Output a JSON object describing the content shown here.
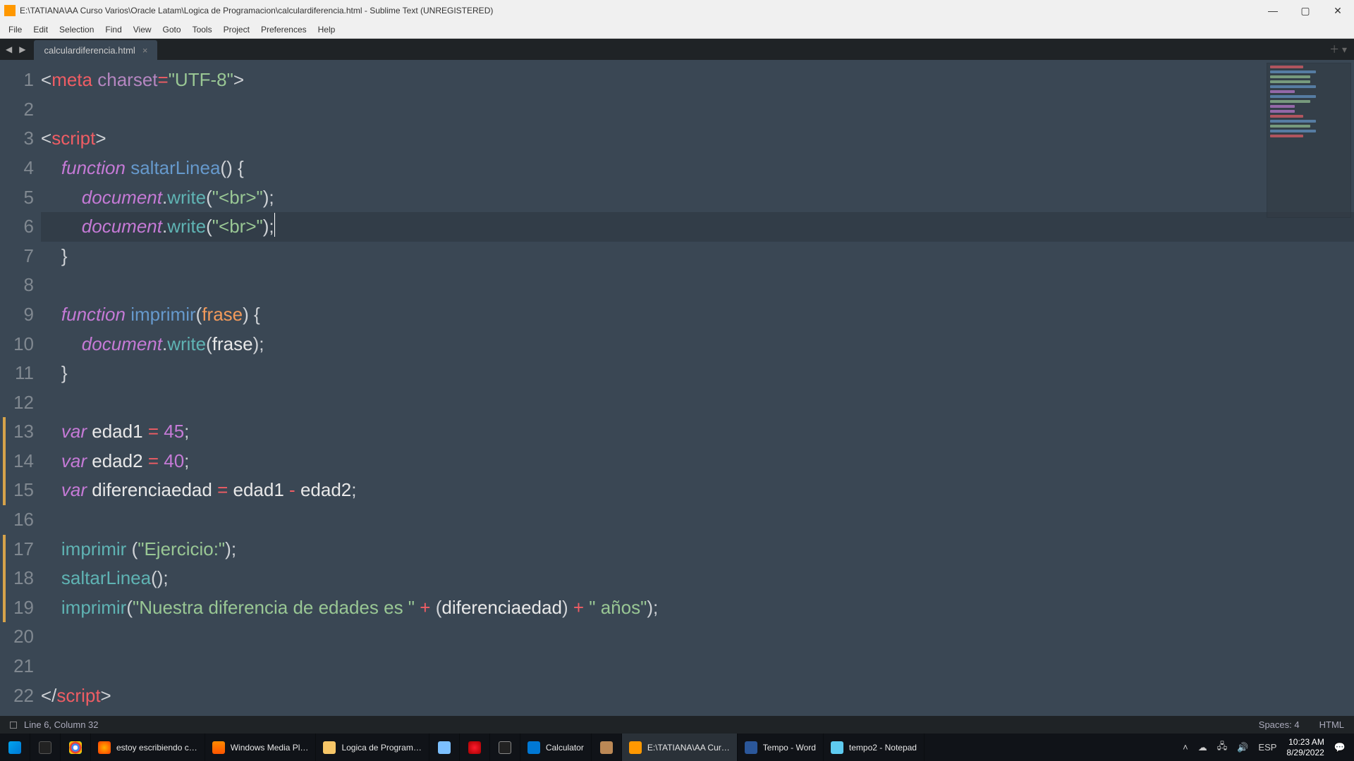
{
  "window": {
    "title_path": "E:\\TATIANA\\AA Curso Varios\\Oracle Latam\\Logica de Programacion\\calculardiferencia.html - Sublime Text (UNREGISTERED)"
  },
  "menu": [
    "File",
    "Edit",
    "Selection",
    "Find",
    "View",
    "Goto",
    "Tools",
    "Project",
    "Preferences",
    "Help"
  ],
  "tab": {
    "name": "calculardiferencia.html"
  },
  "status": {
    "left": "Line 6, Column 32",
    "spaces": "Spaces: 4",
    "syntax": "HTML"
  },
  "gutter": {
    "lines": 22,
    "current": 6,
    "modified": [
      13,
      14,
      15,
      17,
      18,
      19
    ]
  },
  "code": {
    "L1": {
      "pre": "",
      "seg": [
        [
          "t-punc",
          "<"
        ],
        [
          "t-tag",
          "meta"
        ],
        [
          "",
          ""
        ],
        [
          "t-ident",
          " "
        ],
        [
          "t-attr",
          "charset"
        ],
        [
          "t-op",
          "="
        ],
        [
          "t-string",
          "\"UTF-8\""
        ],
        [
          "t-punc",
          ">"
        ]
      ]
    },
    "L2": {
      "pre": "",
      "seg": []
    },
    "L3": {
      "pre": "",
      "seg": [
        [
          "t-punc",
          "<"
        ],
        [
          "t-tag",
          "script"
        ],
        [
          "t-punc",
          ">"
        ]
      ]
    },
    "L4": {
      "pre": "    ",
      "seg": [
        [
          "t-kw",
          "function"
        ],
        [
          "",
          " "
        ],
        [
          "t-fn",
          "saltarLinea"
        ],
        [
          "t-punc",
          "()"
        ],
        [
          "",
          " "
        ],
        [
          "t-punc",
          "{"
        ]
      ]
    },
    "L5": {
      "pre": "        ",
      "seg": [
        [
          "t-kw",
          "document"
        ],
        [
          "t-punc",
          "."
        ],
        [
          "t-call",
          "write"
        ],
        [
          "t-punc",
          "("
        ],
        [
          "t-string",
          "\"<br>\""
        ],
        [
          "t-punc",
          ");"
        ]
      ]
    },
    "L6": {
      "pre": "        ",
      "seg": [
        [
          "t-kw",
          "document"
        ],
        [
          "t-punc",
          "."
        ],
        [
          "t-call",
          "write"
        ],
        [
          "t-punc",
          "("
        ],
        [
          "t-string",
          "\"<br>\""
        ],
        [
          "t-punc",
          ");"
        ]
      ]
    },
    "L7": {
      "pre": "    ",
      "seg": [
        [
          "t-punc",
          "}"
        ]
      ]
    },
    "L8": {
      "pre": "",
      "seg": []
    },
    "L9": {
      "pre": "    ",
      "seg": [
        [
          "t-kw",
          "function"
        ],
        [
          "",
          " "
        ],
        [
          "t-fn",
          "imprimir"
        ],
        [
          "t-punc",
          "("
        ],
        [
          "t-param",
          "frase"
        ],
        [
          "t-punc",
          ")"
        ],
        [
          "",
          " "
        ],
        [
          "t-punc",
          "{"
        ]
      ]
    },
    "L10": {
      "pre": "        ",
      "seg": [
        [
          "t-kw",
          "document"
        ],
        [
          "t-punc",
          "."
        ],
        [
          "t-call",
          "write"
        ],
        [
          "t-punc",
          "("
        ],
        [
          "t-ident",
          "frase"
        ],
        [
          "t-punc",
          ");"
        ]
      ]
    },
    "L11": {
      "pre": "    ",
      "seg": [
        [
          "t-punc",
          "}"
        ]
      ]
    },
    "L12": {
      "pre": "",
      "seg": []
    },
    "L13": {
      "pre": "    ",
      "seg": [
        [
          "t-kwvar",
          "var"
        ],
        [
          "",
          " "
        ],
        [
          "t-ident",
          "edad1"
        ],
        [
          "",
          " "
        ],
        [
          "t-op",
          "="
        ],
        [
          "",
          " "
        ],
        [
          "t-num",
          "45"
        ],
        [
          "t-punc",
          ";"
        ]
      ]
    },
    "L14": {
      "pre": "    ",
      "seg": [
        [
          "t-kwvar",
          "var"
        ],
        [
          "",
          " "
        ],
        [
          "t-ident",
          "edad2"
        ],
        [
          "",
          " "
        ],
        [
          "t-op",
          "="
        ],
        [
          "",
          " "
        ],
        [
          "t-num",
          "40"
        ],
        [
          "t-punc",
          ";"
        ]
      ]
    },
    "L15": {
      "pre": "    ",
      "seg": [
        [
          "t-kwvar",
          "var"
        ],
        [
          "",
          " "
        ],
        [
          "t-ident",
          "diferenciaedad"
        ],
        [
          "",
          " "
        ],
        [
          "t-op",
          "="
        ],
        [
          "",
          " "
        ],
        [
          "t-ident",
          "edad1"
        ],
        [
          "",
          " "
        ],
        [
          "t-op",
          "-"
        ],
        [
          "",
          " "
        ],
        [
          "t-ident",
          "edad2"
        ],
        [
          "t-punc",
          ";"
        ]
      ]
    },
    "L16": {
      "pre": "",
      "seg": []
    },
    "L17": {
      "pre": "    ",
      "seg": [
        [
          "t-call",
          "imprimir"
        ],
        [
          "",
          " "
        ],
        [
          "t-punc",
          "("
        ],
        [
          "t-string",
          "\"Ejercicio:\""
        ],
        [
          "t-punc",
          ");"
        ]
      ]
    },
    "L18": {
      "pre": "    ",
      "seg": [
        [
          "t-call",
          "saltarLinea"
        ],
        [
          "t-punc",
          "();"
        ]
      ]
    },
    "L19": {
      "pre": "    ",
      "seg": [
        [
          "t-call",
          "imprimir"
        ],
        [
          "t-punc",
          "("
        ],
        [
          "t-string",
          "\"Nuestra diferencia de edades es \""
        ],
        [
          "",
          " "
        ],
        [
          "t-op",
          "+"
        ],
        [
          "",
          " "
        ],
        [
          "t-punc",
          "("
        ],
        [
          "t-ident",
          "diferenciaedad"
        ],
        [
          "t-punc",
          ")"
        ],
        [
          "",
          " "
        ],
        [
          "t-op",
          "+"
        ],
        [
          "",
          " "
        ],
        [
          "t-string",
          "\" años\""
        ],
        [
          "t-punc",
          ");"
        ]
      ]
    },
    "L20": {
      "pre": "",
      "seg": []
    },
    "L21": {
      "pre": "",
      "seg": []
    },
    "L22": {
      "pre": "",
      "seg": [
        [
          "t-punc",
          "</"
        ],
        [
          "t-tag",
          "script"
        ],
        [
          "t-punc",
          ">"
        ]
      ]
    }
  },
  "taskbar": {
    "items": [
      {
        "ico": "ico-ff",
        "txt": "estoy escribiendo c…"
      },
      {
        "ico": "ico-wmp",
        "txt": "Windows Media Pl…"
      },
      {
        "ico": "ico-folder",
        "txt": "Logica de Program…"
      },
      {
        "ico": "ico-paint",
        "txt": ""
      },
      {
        "ico": "ico-opera",
        "txt": ""
      },
      {
        "ico": "ico-mpc",
        "txt": ""
      },
      {
        "ico": "ico-calc",
        "txt": "Calculator"
      },
      {
        "ico": "ico-misc",
        "txt": ""
      },
      {
        "ico": "ico-subl",
        "txt": "E:\\TATIANA\\AA Cur…",
        "active": true
      },
      {
        "ico": "ico-word",
        "txt": "Tempo - Word"
      },
      {
        "ico": "ico-note",
        "txt": "tempo2 - Notepad"
      }
    ],
    "tray": {
      "lang": "ESP",
      "time": "10:23 AM",
      "date": "8/29/2022"
    }
  }
}
